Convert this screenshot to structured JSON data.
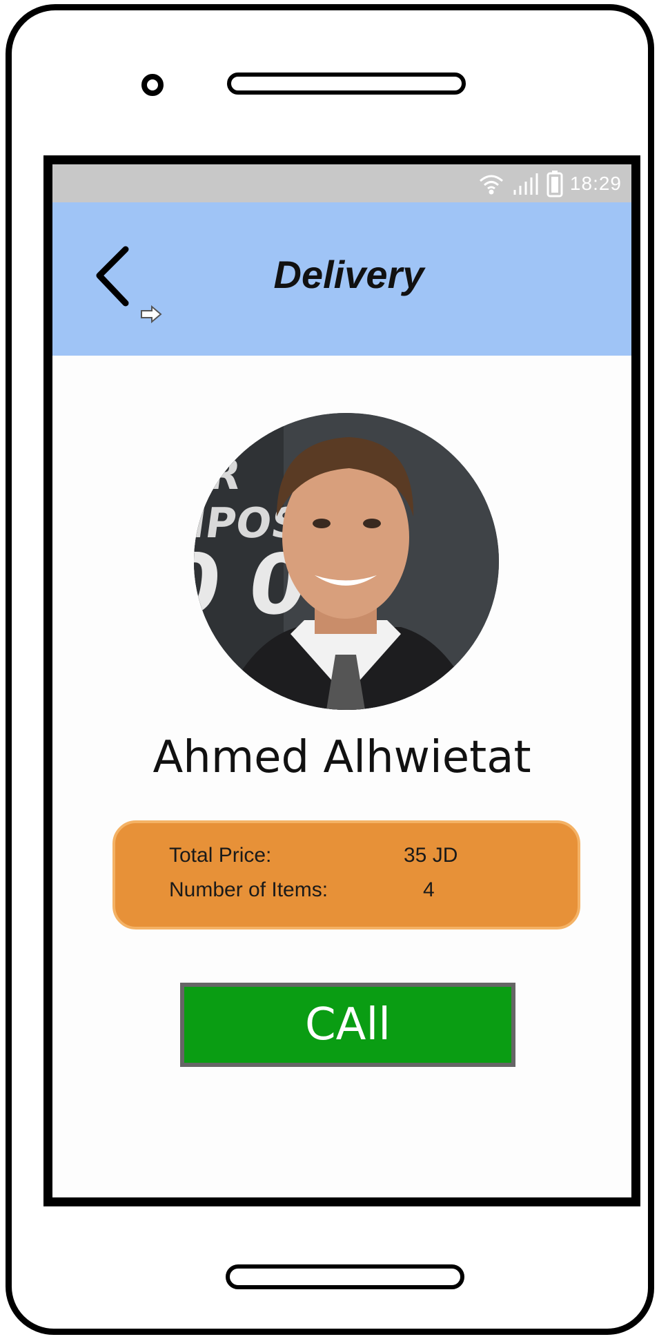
{
  "statusbar": {
    "time": "18:29",
    "icons": [
      "wifi-icon",
      "signal-icon",
      "battery-icon"
    ]
  },
  "appbar": {
    "title": "Delivery",
    "back_icon": "chevron-left-icon",
    "pointer_icon": "arrow-right-icon"
  },
  "profile": {
    "name": "Ahmed Alhwietat"
  },
  "summary": {
    "total_price_label": "Total Price:",
    "total_price_value": "35 JD",
    "items_label": "Number of Items:",
    "items_value": "4"
  },
  "actions": {
    "call_label": "CAll"
  },
  "colors": {
    "appbar": "#9fc4f6",
    "statusbar": "#c8c8c8",
    "summary": "#e79138",
    "call_button": "#0a9d13"
  }
}
